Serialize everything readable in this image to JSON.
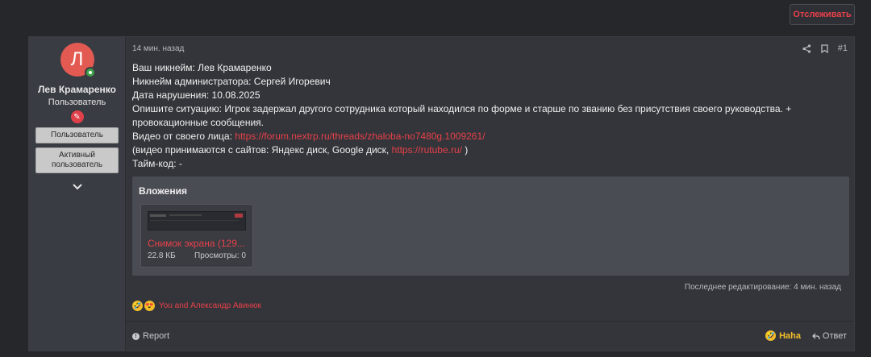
{
  "header": {
    "watch_label": "Отслеживать"
  },
  "user": {
    "avatar_letter": "Л",
    "name": "Лев Крамаренко",
    "title": "Пользователь",
    "badge_glyph": "✎",
    "banners": [
      "Пользователь",
      "Активный пользователь"
    ],
    "expand_glyph": "⌄"
  },
  "post": {
    "time": "14 мин. назад",
    "number": "#1",
    "lines": {
      "l1": "Ваш никнейм: Лев Крамаренко",
      "l2": "Никнейм администратора: Сергей Игоревич",
      "l3": "Дата нарушения: 10.08.2025",
      "l4": "Опишите ситуацию: Игрок задержал другого сотрудника который находился по форме и старше по званию без присутствия своего руководства. + провокационные сообщения.",
      "l5_prefix": "Видео от своего лица: ",
      "l5_link": "https://forum.nextrp.ru/threads/zhaloba-no7480g.1009261/",
      "l6_prefix": "(видео принимаются с сайтов: Яндекс диск, Google диск, ",
      "l6_link": "https://rutube.ru/",
      "l6_suffix": " )",
      "l7": "Тайм-код: -"
    },
    "attachments": {
      "title": "Вложения",
      "file": {
        "name": "Снимок экрана (129...",
        "size": "22.8 КБ",
        "views": "Просмотры: 0"
      }
    },
    "edited": "Последнее редактирование: 4 мин. назад",
    "reactions": {
      "text": "You and Александр Авинюк",
      "icon1": "🤣",
      "icon2": "😍"
    },
    "footer": {
      "report": "Report",
      "haha": "Haha",
      "reply": "Ответ"
    }
  }
}
